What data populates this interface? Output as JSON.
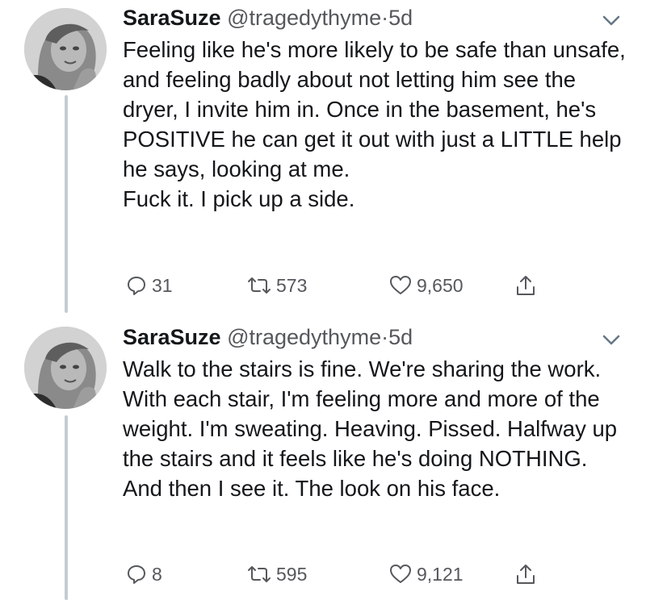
{
  "tweets": [
    {
      "name": "SaraSuze",
      "handle": "@tragedythyme",
      "separator": "·",
      "time": "5d",
      "text_lines": [
        "Feeling like he's more likely to be safe than unsafe, and feeling badly about not letting him see the dryer, I invite him in. Once in the basement, he's POSITIVE he can get it out with just a LITTLE help he says, looking at me.",
        "Fuck it. I pick up a side."
      ],
      "replies": "31",
      "retweets": "573",
      "likes": "9,650",
      "icons": [
        "reply-icon",
        "retweet-icon",
        "like-icon",
        "share-icon",
        "chevron-down-icon"
      ]
    },
    {
      "name": "SaraSuze",
      "handle": "@tragedythyme",
      "separator": "·",
      "time": "5d",
      "text_lines": [
        "Walk to the stairs is fine. We're sharing the work. With each stair, I'm feeling more and more of the weight. I'm sweating. Heaving. Pissed. Halfway up the stairs and it feels like he's doing NOTHING.",
        "And then I see it. The look on his face."
      ],
      "replies": "8",
      "retweets": "595",
      "likes": "9,121",
      "icons": [
        "reply-icon",
        "retweet-icon",
        "like-icon",
        "share-icon",
        "chevron-down-icon"
      ]
    }
  ],
  "colors": {
    "text": "#14171a",
    "secondary": "#55585c",
    "thread_line": "#c4ccd3"
  }
}
